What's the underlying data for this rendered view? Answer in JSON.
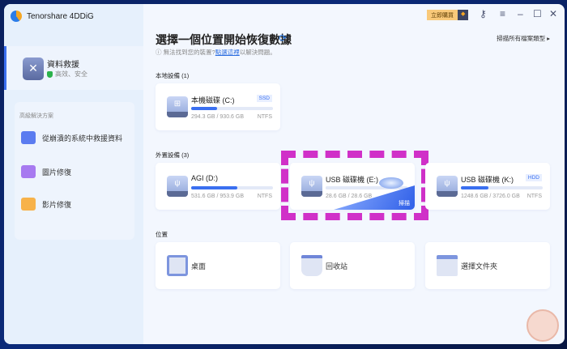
{
  "app": {
    "title": "Tenorshare 4DDiG"
  },
  "sidebar": {
    "active": {
      "title": "資料救援",
      "subtitle": "高效、安全"
    },
    "advanced_heading": "高級解決方案",
    "items": [
      {
        "label": "從崩潰的系統中救援資料"
      },
      {
        "label": "圖片修復"
      },
      {
        "label": "影片修復"
      }
    ]
  },
  "titlebar": {
    "buy": "立即購買"
  },
  "main": {
    "title": "選擇一個位置開始恢復數據",
    "help_prefix": "無法找到您的裝置?",
    "help_link": "點選這裡",
    "help_suffix": "以解決問題。",
    "scan_all": "掃描所有檔案類型 ▸",
    "local_label": "本地設備 (1)",
    "external_label": "外置設備 (3)",
    "location_label": "位置",
    "local": [
      {
        "name": "本機磁碟 (C:)",
        "tag": "SSD",
        "size": "294.3 GB / 930.6 GB",
        "fs": "NTFS",
        "used": 0.32
      }
    ],
    "external": [
      {
        "name": "AGI (D:)",
        "size": "531.6 GB / 953.9 GB",
        "fs": "NTFS",
        "used": 0.56
      },
      {
        "name": "USB 磁碟機 (E:)",
        "size": "28.6 GB / 28.6 GB",
        "scan": "掃描",
        "used": 1.0
      },
      {
        "name": "USB 磁碟機 (K:)",
        "tag": "HDD",
        "size": "1248.6 GB / 3726.0 GB",
        "fs": "NTFS",
        "used": 0.34
      }
    ],
    "locations": [
      {
        "label": "桌面"
      },
      {
        "label": "回收站"
      },
      {
        "label": "選擇文件夾"
      }
    ]
  }
}
